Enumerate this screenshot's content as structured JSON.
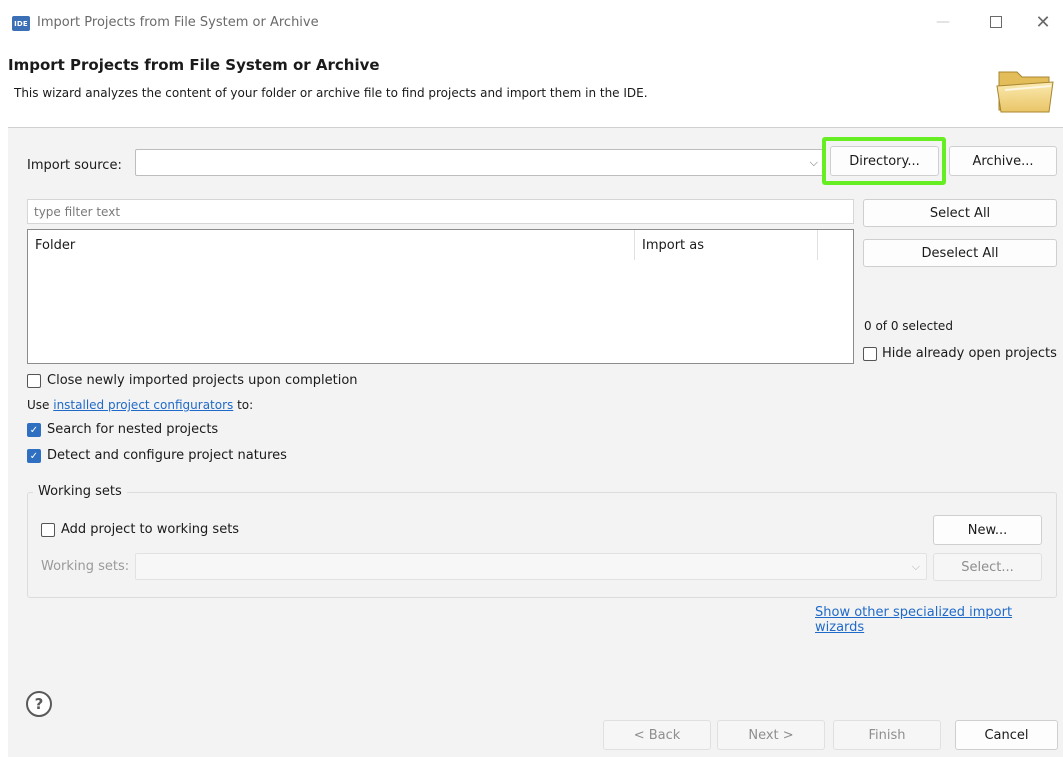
{
  "window": {
    "app_badge": "IDE",
    "title": "Import Projects from File System or Archive",
    "min_glyph": "—",
    "close_glyph": "✕"
  },
  "header": {
    "title": "Import Projects from File System or Archive",
    "description": "This wizard analyzes the content of your folder or archive file to find projects and import them in the IDE."
  },
  "import_source": {
    "label": "Import source:",
    "value": "",
    "directory_button": "Directory...",
    "archive_button": "Archive..."
  },
  "filter": {
    "placeholder": "type filter text"
  },
  "table": {
    "columns": [
      "Folder",
      "Import as"
    ],
    "rows": []
  },
  "selection": {
    "select_all": "Select All",
    "deselect_all": "Deselect All",
    "count_text": "0 of 0 selected",
    "hide_open_label": "Hide already open projects",
    "hide_open_checked": false
  },
  "options": {
    "close_imported_label": "Close newly imported projects upon completion",
    "use_prefix": "Use ",
    "configurators_link": "installed project configurators",
    "use_suffix": " to:",
    "nested_label": "Search for nested projects",
    "natures_label": "Detect and configure project natures",
    "check_glyph": "✓"
  },
  "working_sets": {
    "legend": "Working sets",
    "add_label": "Add project to working sets",
    "new_button": "New...",
    "sets_label": "Working sets:",
    "select_button": "Select..."
  },
  "other_wizards_link": "Show other specialized import wizards",
  "footer": {
    "help_glyph": "?",
    "back": "< Back",
    "next": "Next >",
    "finish": "Finish",
    "cancel": "Cancel"
  },
  "colors": {
    "highlight": "#66ee22",
    "accent": "#2f6fc2",
    "link": "#1f6ac9"
  }
}
